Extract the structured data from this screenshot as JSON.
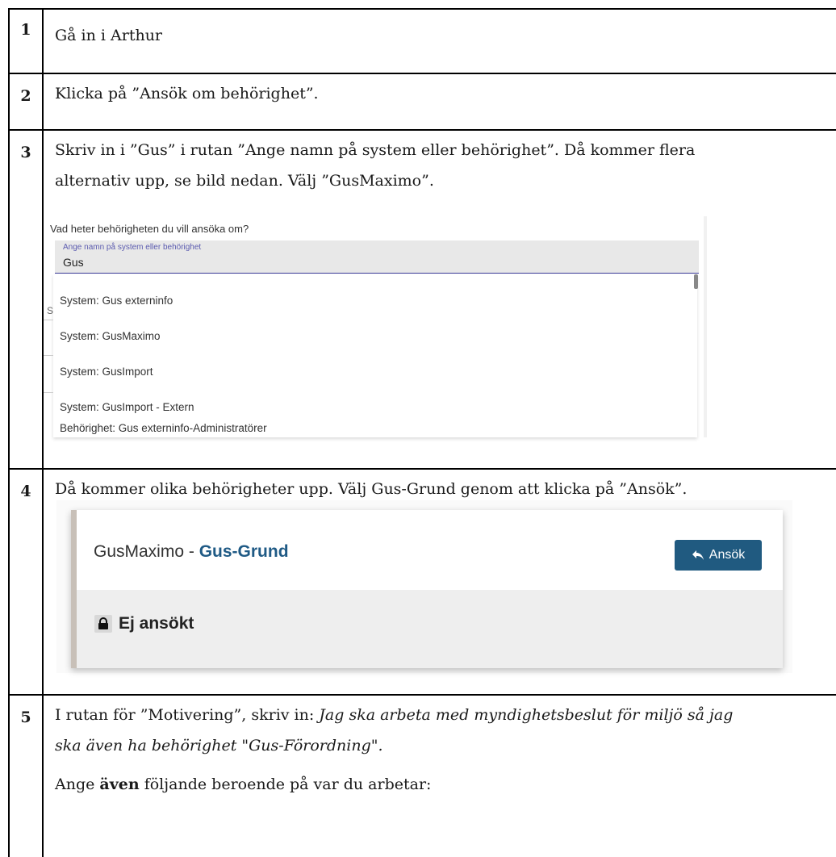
{
  "steps": [
    {
      "num": "1",
      "text": "Gå in i Arthur"
    },
    {
      "num": "2",
      "text": "Klicka på ”Ansök om behörighet”."
    },
    {
      "num": "3",
      "line1": "Skriv in i ”Gus” i rutan ”Ange namn på system eller behörighet”. Då kommer flera",
      "line2": "alternativ upp, se bild nedan. Välj ”GusMaximo”."
    },
    {
      "num": "4",
      "text": "Då kommer olika behörigheter upp. Välj Gus-Grund genom att klicka på ”Ansök”."
    },
    {
      "num": "5",
      "line1_prefix": "I rutan för ”Motivering”, skriv in: ",
      "line1_italic": "Jag ska arbeta med myndighetsbeslut för miljö så jag",
      "line2_italic": "ska även ha behörighet \"Gus-Förordning\".",
      "line3_prefix": "Ange ",
      "line3_bold": "även",
      "line3_suffix": " följande beroende på var du arbetar:"
    }
  ],
  "search_screenshot": {
    "question": "Vad heter behörigheten du vill ansöka om?",
    "field_label": "Ange namn på system eller behörighet",
    "field_value": "Gus",
    "edge_letter": "S",
    "options": [
      "System: Gus externinfo",
      "System: GusMaximo",
      "System: GusImport",
      "System: GusImport - Extern",
      "Behörighet: Gus externinfo-Administratörer"
    ]
  },
  "permission_screenshot": {
    "system": "GusMaximo",
    "separator": " - ",
    "role": "Gus-Grund",
    "button_label": "Ansök",
    "status": "Ej ansökt",
    "accent_color": "#205a80"
  }
}
